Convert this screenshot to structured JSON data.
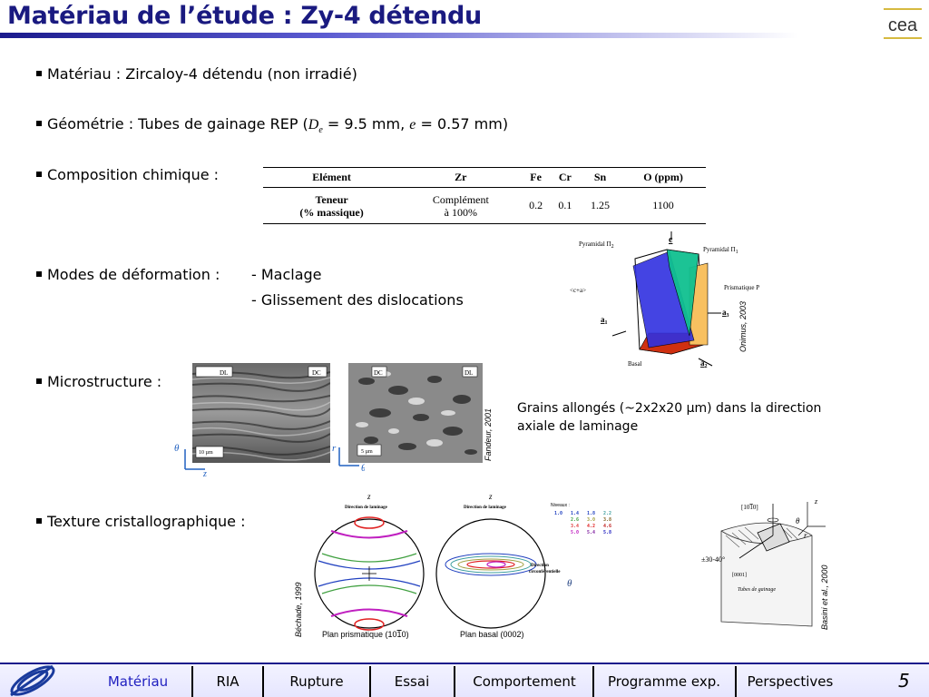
{
  "title": "Matériau de l’étude : Zy-4 détendu",
  "logo_text": "cea",
  "bullets": {
    "materiau": "Matériau : Zircaloy-4 détendu (non irradié)",
    "geometrie_prefix": "Géométrie : Tubes de gainage REP (",
    "geometrie_de": "D",
    "geometrie_de_sub": "e",
    "geometrie_mid": " = 9.5 mm, ",
    "geometrie_e": "e",
    "geometrie_suffix": " = 0.57 mm)",
    "composition": "Composition chimique :",
    "modes": "Modes de déformation :",
    "modes_1": "- Maclage",
    "modes_2": "- Glissement des dislocations",
    "microstructure": "Microstructure :",
    "texture": "Texture cristallographique :"
  },
  "composition_table": {
    "headers": [
      "Elément",
      "Zr",
      "Fe",
      "Cr",
      "Sn",
      "O (ppm)"
    ],
    "row_label_1": "Teneur",
    "row_label_2": "(% massique)",
    "zr_1": "Complément",
    "zr_2": "à 100%",
    "fe": "0.2",
    "cr": "0.1",
    "sn": "1.25",
    "o": "1100"
  },
  "crystal": {
    "c": "c",
    "pyr2": "Pyramidal Π",
    "pyr2_sub": "2",
    "pyr1": "Pyramidal Π",
    "pyr1_sub": "1",
    "prism": "Prismatique P",
    "ca": "<c+a>",
    "a1": "a",
    "a1_sub": "1",
    "a2": "a",
    "a2_sub": "2",
    "a3": "a",
    "a3_sub": "3",
    "basal": "Basal",
    "credit": "Onimus, 2003"
  },
  "micro": {
    "left_dl": "DL",
    "left_dc": "DC",
    "left_scale": "10 µm",
    "left_theta": "θ",
    "left_z": "z",
    "right_dc": "DC",
    "right_dl": "DL",
    "right_scale": "5 µm",
    "right_r": "r",
    "right_theta": "θ",
    "credit": "Fandeur, 2001",
    "caption_1": "Grains allongés (~2x2x20 µm) dans la direction",
    "caption_2": "axiale de laminage"
  },
  "texture": {
    "z1": "z",
    "dir1": "Direction de laminage",
    "z2": "z",
    "dir2": "Direction de laminage",
    "dir_circ_1": "Direction",
    "dir_circ_2": "circonférentielle",
    "theta": "θ",
    "niveaux": "Niveaux :",
    "levels": [
      [
        "1.0",
        "1.4",
        "1.8",
        "2.2"
      ],
      [
        "2.6",
        "3.0",
        "3.8",
        "3.0"
      ],
      [
        "3.4",
        "4.2",
        "4.6",
        ""
      ],
      [
        "5.0",
        "5.4",
        "5.8",
        ""
      ]
    ],
    "cap_prism": "Plan prismatique (10",
    "cap_prism_bar": "1",
    "cap_prism_end": "0)",
    "cap_basal": "Plan basal (0002)",
    "credit_left": "Béchade, 1999",
    "tube_1010": "[10",
    "tube_1010_bar": "1",
    "tube_1010_end": "0]",
    "tube_angle": "±30-40°",
    "tube_0001": "[0001]",
    "tube_label": "Tubes de gainage",
    "tube_z": "z",
    "tube_theta": "θ",
    "tube_r": "r",
    "credit_right": "Basini et al., 2000"
  },
  "nav": {
    "items": [
      "Matériau",
      "RIA",
      "Rupture",
      "Essai",
      "Comportement",
      "Programme exp.",
      "Perspectives"
    ],
    "page": "5"
  },
  "colors": {
    "title": "#1a1a80",
    "nav_active": "#2020c0",
    "accent": "#1a1a8c"
  }
}
